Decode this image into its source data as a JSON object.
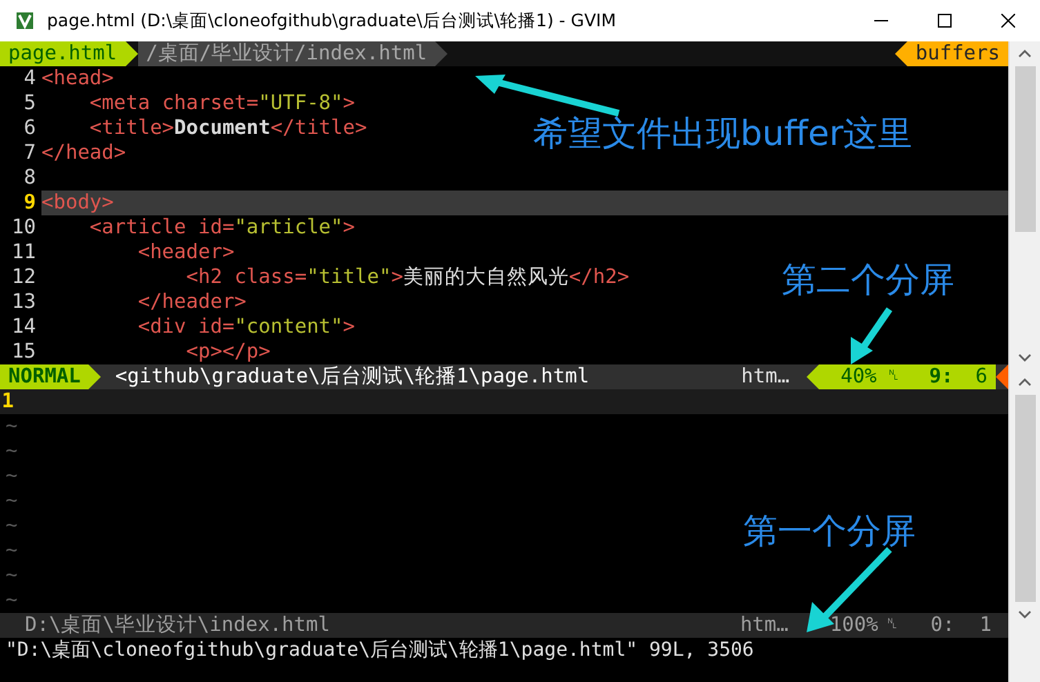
{
  "window": {
    "title": "page.html (D:\\桌面\\cloneofgithub\\graduate\\后台测试\\轮播1) - GVIM"
  },
  "tabline": {
    "current": "page.html",
    "path": "/桌面/毕业设计/index.html",
    "buffers": "buffers"
  },
  "upper_split": {
    "lines": [
      {
        "number": "4",
        "current": false,
        "tokens": [
          {
            "kind": "tag",
            "text": "<head>"
          }
        ]
      },
      {
        "number": "5",
        "current": false,
        "tokens": [
          {
            "kind": "tag",
            "text": "    <meta "
          },
          {
            "kind": "attr",
            "text": "charset="
          },
          {
            "kind": "string",
            "text": "\"UTF-8\""
          },
          {
            "kind": "tag",
            "text": ">"
          }
        ]
      },
      {
        "number": "6",
        "current": false,
        "tokens": [
          {
            "kind": "tag",
            "text": "    <title>"
          },
          {
            "kind": "bold",
            "text": "Document"
          },
          {
            "kind": "tag",
            "text": "</title>"
          }
        ]
      },
      {
        "number": "7",
        "current": false,
        "tokens": [
          {
            "kind": "tag",
            "text": "</head>"
          }
        ]
      },
      {
        "number": "8",
        "current": false
      },
      {
        "number": "9",
        "current": true,
        "tokens": [
          {
            "kind": "tag",
            "text": "<body>"
          }
        ]
      },
      {
        "number": "10",
        "current": false,
        "tokens": [
          {
            "kind": "tag",
            "text": "    <article "
          },
          {
            "kind": "attr",
            "text": "id="
          },
          {
            "kind": "string",
            "text": "\"article\""
          },
          {
            "kind": "tag",
            "text": ">"
          }
        ]
      },
      {
        "number": "11",
        "current": false,
        "tokens": [
          {
            "kind": "tag",
            "text": "        <header>"
          }
        ]
      },
      {
        "number": "12",
        "current": false,
        "tokens": [
          {
            "kind": "tag",
            "text": "            <h2 "
          },
          {
            "kind": "attr",
            "text": "class="
          },
          {
            "kind": "string",
            "text": "\"title\""
          },
          {
            "kind": "tag",
            "text": ">"
          },
          {
            "kind": "text",
            "text": "美丽的大自然风光"
          },
          {
            "kind": "tag",
            "text": "</h2>"
          }
        ]
      },
      {
        "number": "13",
        "current": false,
        "tokens": [
          {
            "kind": "tag",
            "text": "        </header>"
          }
        ]
      },
      {
        "number": "14",
        "current": false,
        "tokens": [
          {
            "kind": "tag",
            "text": "        <div "
          },
          {
            "kind": "attr",
            "text": "id="
          },
          {
            "kind": "string",
            "text": "\"content\""
          },
          {
            "kind": "tag",
            "text": ">"
          }
        ]
      },
      {
        "number": "15",
        "current": false,
        "tokens": [
          {
            "kind": "tag",
            "text": "            <p></p>"
          }
        ]
      }
    ],
    "status": {
      "mode": "NORMAL",
      "file": "<github\\graduate\\后台测试\\轮播1\\page.html",
      "filetype": "htm…",
      "percent": "40%",
      "line_symbol": "␤",
      "line": "9:",
      "column": "6"
    }
  },
  "lower_split": {
    "lines": [
      {
        "number": "1",
        "current": true
      }
    ],
    "filler": [
      "~",
      "~",
      "~",
      "~",
      "~",
      "~",
      "~",
      "~"
    ],
    "status": {
      "file": "D:\\桌面\\毕业设计\\index.html",
      "filetype": "htm…",
      "percent": "100%",
      "line_symbol": "␤",
      "line": "0:",
      "column": "1"
    }
  },
  "command_line": "\"D:\\桌面\\cloneofgithub\\graduate\\后台测试\\轮播1\\page.html\" 99L, 3506",
  "annotations": [
    {
      "text": "希望文件出现buffer这里"
    },
    {
      "text": "第二个分屏"
    },
    {
      "text": "第一个分屏"
    }
  ]
}
